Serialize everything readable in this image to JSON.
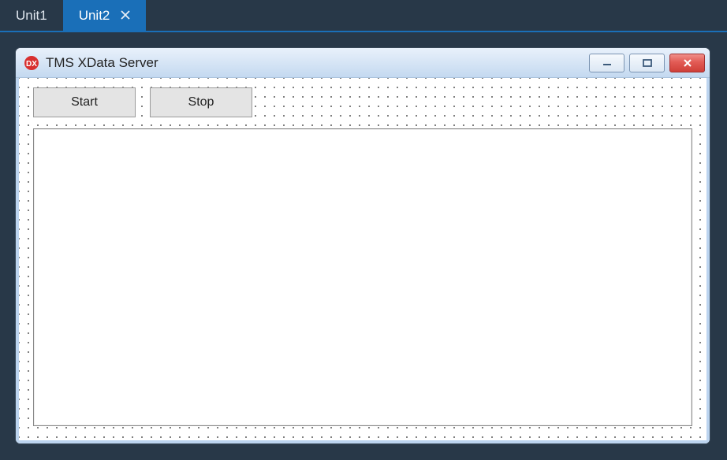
{
  "tabs": [
    {
      "label": "Unit1",
      "active": false
    },
    {
      "label": "Unit2",
      "active": true
    }
  ],
  "form": {
    "title": "TMS XData Server",
    "icon_name": "dx-icon",
    "buttons": {
      "start": "Start",
      "stop": "Stop"
    }
  },
  "window_controls": {
    "minimize": "minimize",
    "maximize": "maximize",
    "close": "close"
  }
}
